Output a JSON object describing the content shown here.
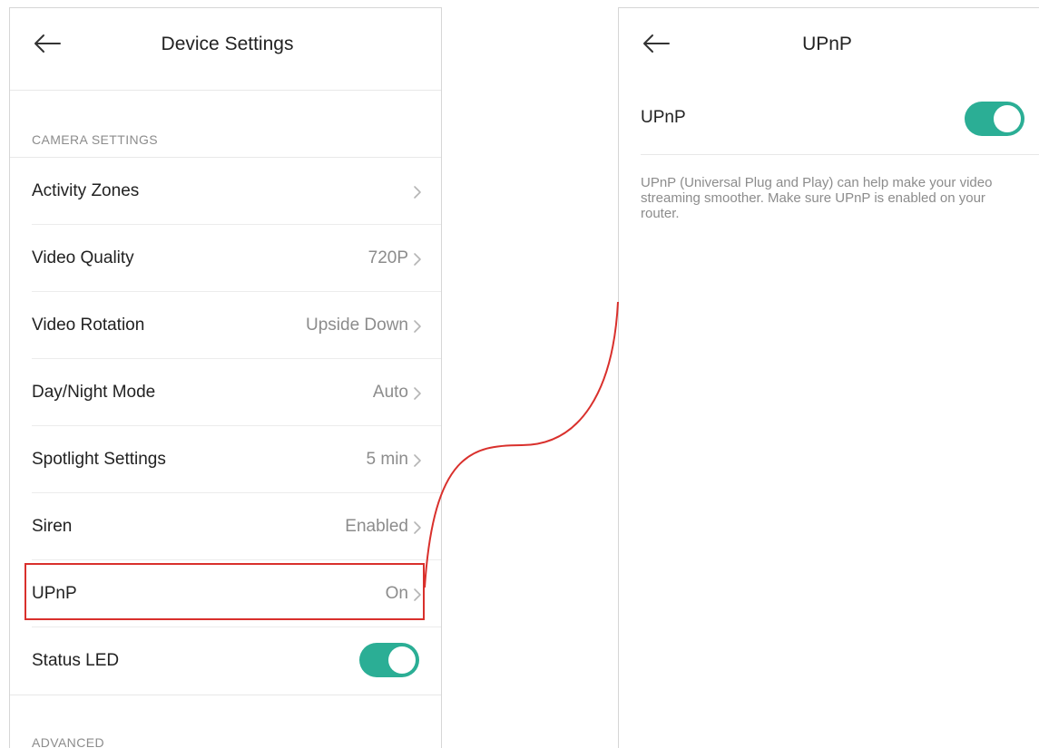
{
  "colors": {
    "toggle_on": "#2bae95",
    "annotation": "#d9302c",
    "secondary_text": "#8c8c8c"
  },
  "device_settings": {
    "back_icon": "arrow-left-icon",
    "title": "Device Settings",
    "camera_section": "CAMERA SETTINGS",
    "rows": [
      {
        "label": "Activity Zones",
        "value": ""
      },
      {
        "label": "Video Quality",
        "value": "720P"
      },
      {
        "label": "Video Rotation",
        "value": "Upside Down"
      },
      {
        "label": "Day/Night Mode",
        "value": "Auto"
      },
      {
        "label": "Spotlight Settings",
        "value": "5 min"
      },
      {
        "label": "Siren",
        "value": "Enabled"
      },
      {
        "label": "UPnP",
        "value": "On"
      }
    ],
    "status_led": {
      "label": "Status LED",
      "enabled": true
    },
    "advanced_section": "ADVANCED"
  },
  "upnp_page": {
    "back_icon": "arrow-left-icon",
    "title": "UPnP",
    "toggle": {
      "label": "UPnP",
      "enabled": true
    },
    "description": "UPnP (Universal Plug and Play) can help make your video streaming smoother. Make sure UPnP is enabled on your router."
  }
}
